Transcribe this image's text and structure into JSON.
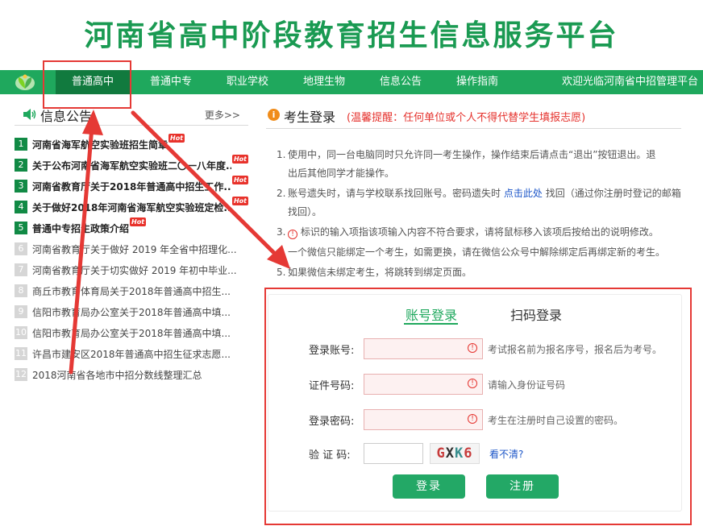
{
  "banner": {
    "title": "河南省高中阶段教育招生信息服务平台"
  },
  "nav": {
    "items": [
      {
        "label": "普通高中",
        "active": true
      },
      {
        "label": "普通中专",
        "active": false
      },
      {
        "label": "职业学校",
        "active": false
      },
      {
        "label": "地理生物",
        "active": false
      },
      {
        "label": "信息公告",
        "active": false
      },
      {
        "label": "操作指南",
        "active": false
      }
    ],
    "welcome": "欢迎光临河南省中招管理平台"
  },
  "news": {
    "title": "信息公告",
    "more": "更多>>",
    "hot_label": "Hot",
    "items": [
      {
        "num": "1",
        "text": "河南省海军航空实验班招生简章",
        "hot": true,
        "bold": true
      },
      {
        "num": "2",
        "text": "关于公布河南省海军航空实验班二〇一八年度...",
        "hot": true,
        "bold": true
      },
      {
        "num": "3",
        "text": "河南省教育厅关于2018年普通高中招生工作...",
        "hot": true,
        "bold": true
      },
      {
        "num": "4",
        "text": "关于做好2018年河南省海军航空实验班定检...",
        "hot": true,
        "bold": true
      },
      {
        "num": "5",
        "text": "普通中专招生政策介绍",
        "hot": true,
        "bold": true
      },
      {
        "num": "6",
        "text": "河南省教育厅关于做好 2019 年全省中招理化...",
        "hot": false,
        "bold": false
      },
      {
        "num": "7",
        "text": "河南省教育厅关于切实做好 2019 年初中毕业...",
        "hot": false,
        "bold": false
      },
      {
        "num": "8",
        "text": "商丘市教育体育局关于2018年普通高中招生...",
        "hot": false,
        "bold": false
      },
      {
        "num": "9",
        "text": "信阳市教育局办公室关于2018年普通高中填...",
        "hot": false,
        "bold": false
      },
      {
        "num": "10",
        "text": "信阳市教育局办公室关于2018年普通高中填...",
        "hot": false,
        "bold": false
      },
      {
        "num": "11",
        "text": "许昌市建安区2018年普通高中招生征求志愿...",
        "hot": false,
        "bold": false
      },
      {
        "num": "12",
        "text": "2018河南省各地市中招分数线整理汇总",
        "hot": false,
        "bold": false
      }
    ]
  },
  "login": {
    "title": "考生登录",
    "tip": "(温馨提醒：任何单位或个人不得代替学生填报志愿)",
    "info_glyph": "i",
    "rules": {
      "r1_idx": "1.",
      "r1_a": "使用中，同一台电脑同时只允许同一考生操作，操作结束后请点击“退出”按钮退出。退",
      "r1_b": "出后其他同学才能操作。",
      "r2_idx": "2.",
      "r2_a": "账号遗失时，请与学校联系找回账号。密码遗失时",
      "r2_link": "点击此处",
      "r2_c": "找回（通过你注册时登记的邮箱",
      "r2_d": "找回）。",
      "r3_idx": "3.",
      "r3_glyph": "!",
      "r3_text": "标识的输入项指该项输入内容不符合要求，请将鼠标移入该项后按给出的说明修改。",
      "r4_idx": "4.",
      "r4_text": "一个微信只能绑定一个考生，如需更换，请在微信公众号中解除绑定后再绑定新的考生。",
      "r5_idx": "5.",
      "r5_text": "如果微信未绑定考生，将跳转到绑定页面。"
    },
    "tabs": {
      "account": "账号登录",
      "scan": "扫码登录"
    },
    "form": {
      "account_label": "登录账号:",
      "account_hint": "考试报名前为报名序号，报名后为考号。",
      "id_label": "证件号码:",
      "id_hint": "请输入身份证号码",
      "pwd_label": "登录密码:",
      "pwd_hint": "考生在注册时自己设置的密码。",
      "captcha_label": "验 证 码:",
      "captcha_chars": [
        "G",
        "X",
        "K",
        "6"
      ],
      "captcha_unclear": "看不清?",
      "err_glyph": "!"
    },
    "buttons": {
      "login": "登录",
      "register": "注册"
    }
  },
  "colors": {
    "brand_green": "#1fa85d",
    "nav_active": "#117a3e",
    "warning_red": "#e5322d",
    "annotation_red": "#e53935"
  }
}
